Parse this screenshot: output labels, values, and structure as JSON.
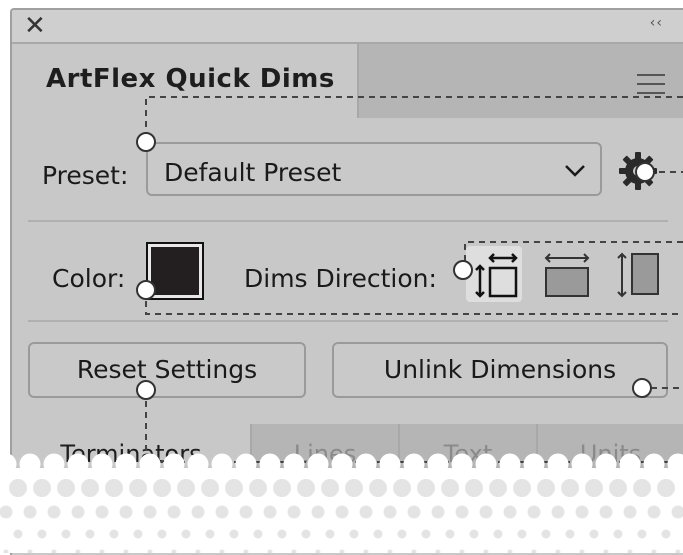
{
  "window": {
    "close_glyph": "✕",
    "collapse_glyph": "‹‹"
  },
  "header": {
    "title": "ArtFlex Quick Dims"
  },
  "preset": {
    "label": "Preset:",
    "value": "Default Preset"
  },
  "color": {
    "label": "Color:",
    "swatch_hex": "#231f20"
  },
  "dims_direction": {
    "label": "Dims Direction:",
    "options": [
      "both-directions-icon",
      "horizontal-icon",
      "vertical-icon"
    ],
    "selected": "both-directions-icon"
  },
  "buttons": {
    "reset": "Reset Settings",
    "unlink": "Unlink Dimensions"
  },
  "subtabs": [
    "Terminators",
    "Lines",
    "Text",
    "Units"
  ],
  "colors": {
    "panel": "#c8c8c8",
    "tabbar": "#b5b5b5",
    "text": "#1a1a1a"
  }
}
